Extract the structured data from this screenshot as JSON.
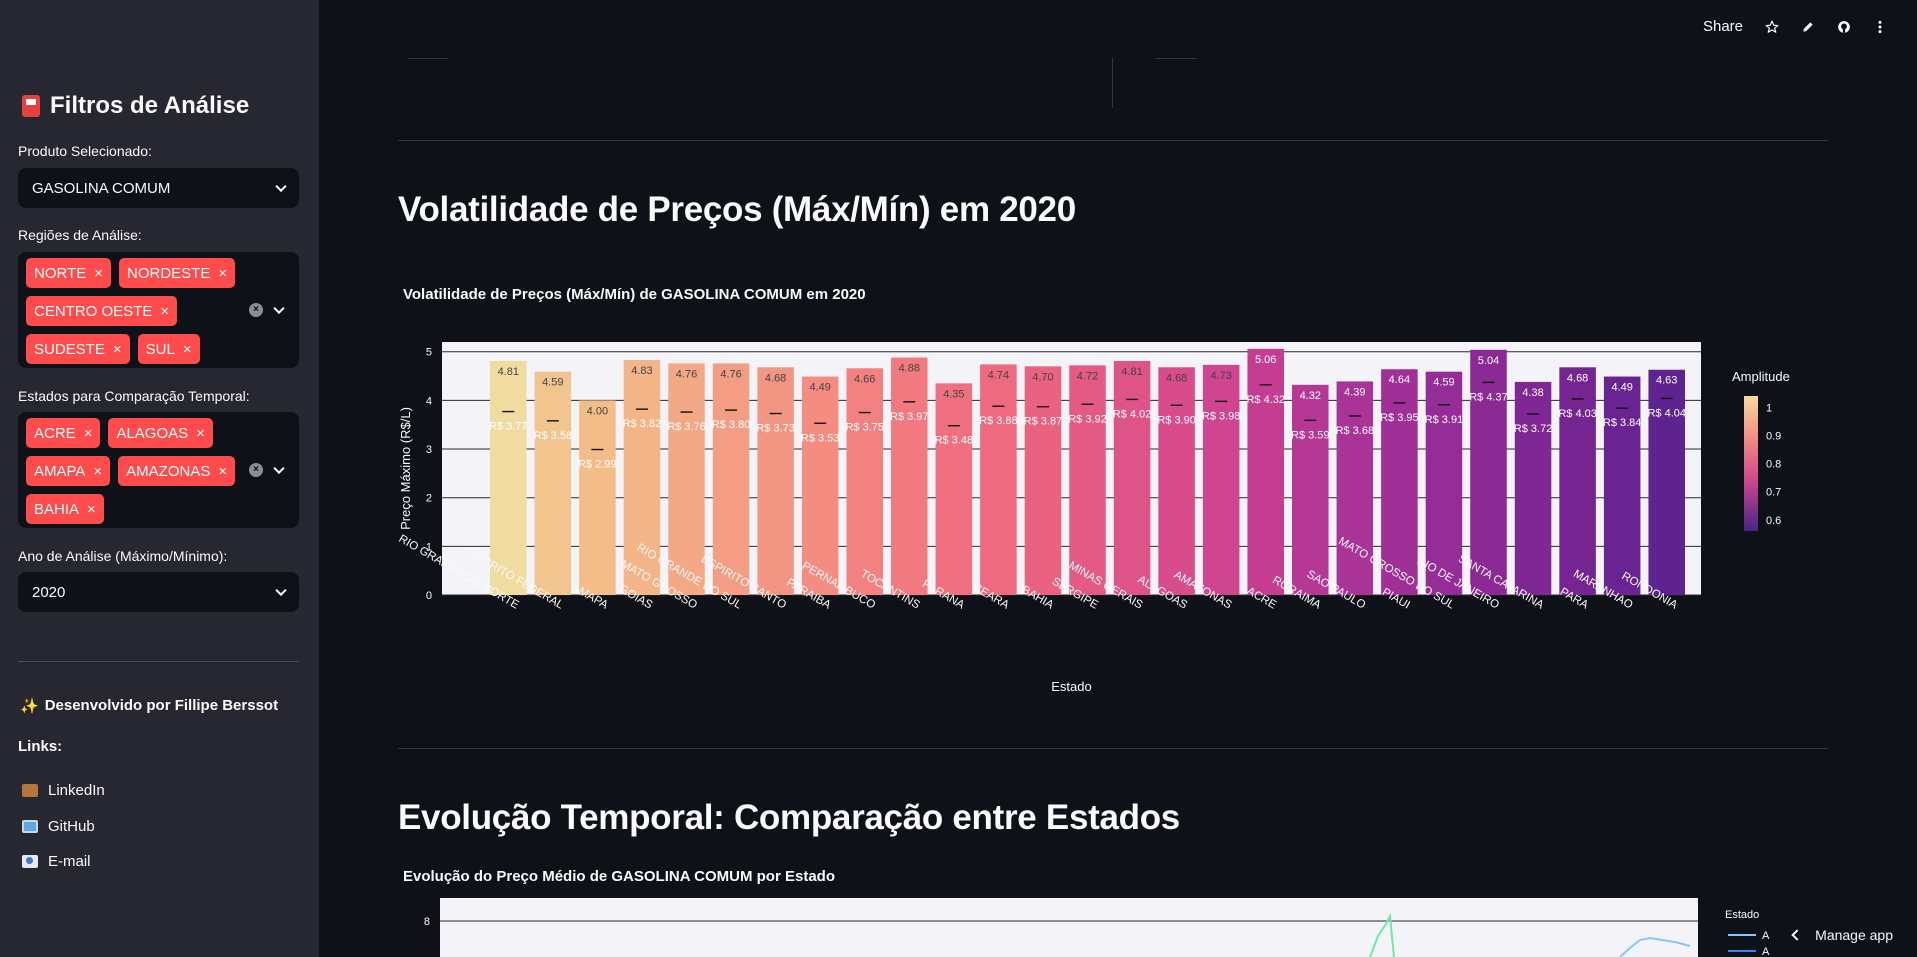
{
  "sidebar": {
    "title": "Filtros de Análise",
    "produto_label": "Produto Selecionado:",
    "produto_value": "GASOLINA COMUM",
    "regioes_label": "Regiões de Análise:",
    "regioes": [
      "NORTE",
      "NORDESTE",
      "CENTRO OESTE",
      "SUDESTE",
      "SUL"
    ],
    "estados_label": "Estados para Comparação Temporal:",
    "estados": [
      "ACRE",
      "ALAGOAS",
      "AMAPA",
      "AMAZONAS",
      "BAHIA"
    ],
    "ano_label": "Ano de Análise (Máximo/Mínimo):",
    "ano_value": "2020",
    "dev": "Desenvolvido por Fillipe Berssot",
    "links_title": "Links:",
    "links": [
      "LinkedIn",
      "GitHub",
      "E-mail"
    ]
  },
  "topbar": {
    "share": "Share"
  },
  "section1_title": "Volatilidade de Preços (Máx/Mín) em 2020",
  "section2_title": "Evolução Temporal: Comparação entre Estados",
  "chart2_title": "Evolução do Preço Médio de GASOLINA COMUM por Estado",
  "chart2_legend_title": "Estado",
  "chart2_legend_items": [
    "A",
    "A"
  ],
  "chart2_ytick": "8",
  "manage_app": "Manage app",
  "chart_data": {
    "type": "bar",
    "title": "Volatilidade de Preços (Máx/Mín) de GASOLINA COMUM em 2020",
    "xlabel": "Estado",
    "ylabel": "Preço Máximo (R$/L)",
    "ylim": [
      0,
      5.2
    ],
    "yticks": [
      0,
      1,
      2,
      3,
      4,
      5
    ],
    "colorbar_title": "Amplitude",
    "colorbar_ticks": [
      "1",
      "0.9",
      "0.8",
      "0.7",
      "0.6"
    ],
    "colorbar_range": [
      0.56,
      1.04
    ],
    "categories": [
      "RIO GRANDE DO NORTE",
      "DISTRITO FEDERAL",
      "AMAPA",
      "GOIAS",
      "MATO GROSSO",
      "RIO GRANDE DO SUL",
      "ESPIRITO SANTO",
      "PARAIBA",
      "PERNAMBUCO",
      "TOCANTINS",
      "PARANA",
      "CEARA",
      "BAHIA",
      "SERGIPE",
      "MINAS GERAIS",
      "ALAGOAS",
      "AMAZONAS",
      "ACRE",
      "RORAIMA",
      "SAO PAULO",
      "PIAUI",
      "MATO GROSSO DO SUL",
      "RIO DE JANEIRO",
      "SANTA CATARINA",
      "PARA",
      "MARANHAO",
      "RONDONIA"
    ],
    "max_values": [
      4.81,
      4.59,
      4.0,
      4.83,
      4.76,
      4.76,
      4.68,
      4.49,
      4.66,
      4.88,
      4.35,
      4.74,
      4.7,
      4.72,
      4.81,
      4.68,
      4.73,
      5.06,
      4.32,
      4.39,
      4.64,
      4.59,
      5.04,
      4.38,
      4.68,
      4.49,
      4.63
    ],
    "max_labels": [
      "4.81",
      "4.59",
      "4.00",
      "4.83",
      "4.76",
      "4.76",
      "4.68",
      "4.49",
      "4.66",
      "4.88",
      "4.35",
      "4.74",
      "4.70",
      "4.72",
      "4.81",
      "4.68",
      "4.73",
      "5.06",
      "4.32",
      "4.39",
      "4.64",
      "4.59",
      "5.04",
      "4.38",
      "4.68",
      "4.49",
      "4.63"
    ],
    "min_values": [
      3.77,
      3.58,
      2.99,
      3.82,
      3.76,
      3.8,
      3.73,
      3.53,
      3.75,
      3.97,
      3.48,
      3.88,
      3.87,
      3.92,
      4.02,
      3.9,
      3.98,
      4.32,
      3.59,
      3.68,
      3.95,
      3.91,
      4.37,
      3.72,
      4.03,
      3.84,
      4.04
    ],
    "min_labels": [
      "R$ 3.77",
      "R$ 3.58",
      "R$ 2.99",
      "R$ 3.82",
      "R$ 3.76",
      "R$ 3.80",
      "R$ 3.73",
      "R$ 3.53",
      "R$ 3.75",
      "R$ 3.97",
      "R$ 3.48",
      "R$ 3.88",
      "R$ 3.87",
      "R$ 3.92",
      "R$ 4.02",
      "R$ 3.90",
      "R$ 3.98",
      "R$ 4.32",
      "R$ 3.59",
      "R$ 3.68",
      "R$ 3.95",
      "R$ 3.91",
      "R$ 4.37",
      "R$ 3.72",
      "R$ 4.03",
      "R$ 3.84",
      "R$ 4.04"
    ],
    "colors": [
      "#f0dca0",
      "#f2c58e",
      "#f3bd8a",
      "#f3b487",
      "#f3a986",
      "#f39e84",
      "#f39583",
      "#f48c82",
      "#f48181",
      "#f37980",
      "#f0707f",
      "#ee6a80",
      "#ea6282",
      "#e45a85",
      "#de5388",
      "#d84c8b",
      "#cf4590",
      "#c43d93",
      "#b63896",
      "#aa3397",
      "#a02f98",
      "#952c97",
      "#8b2995",
      "#7f2794",
      "#752592",
      "#6a2491",
      "#5e238f"
    ]
  }
}
